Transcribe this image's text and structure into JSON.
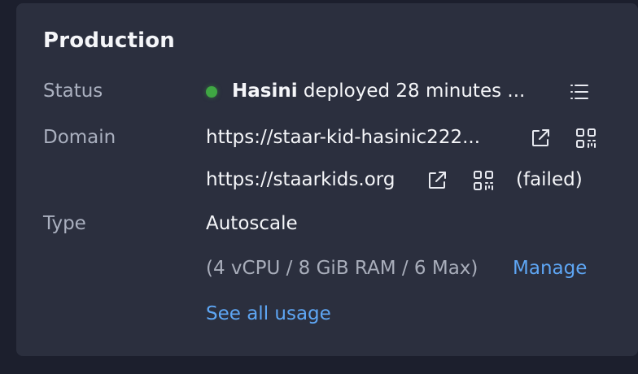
{
  "section": {
    "title": "Production"
  },
  "status": {
    "label": "Status",
    "user": "Hasini",
    "message": "deployed 28 minutes ...",
    "indicator_color": "#3fa743"
  },
  "domain": {
    "label": "Domain",
    "primary_url": "https://staar-kid-hasinic222...",
    "custom_url": "https://staarkids.org",
    "custom_status": "(failed)"
  },
  "type": {
    "label": "Type",
    "value": "Autoscale",
    "specs": "(4 vCPU / 8 GiB RAM / 6 Max)",
    "manage_label": "Manage",
    "usage_link": "See all usage"
  },
  "icons": {
    "status_menu": "list-icon",
    "open_primary": "external-link-icon",
    "qr_primary": "qr-code-icon",
    "open_custom": "external-link-icon",
    "qr_custom": "qr-code-icon"
  },
  "colors": {
    "card_bg": "#2b2f3e",
    "page_bg": "#1c1f2d",
    "link": "#5ea6f4"
  }
}
